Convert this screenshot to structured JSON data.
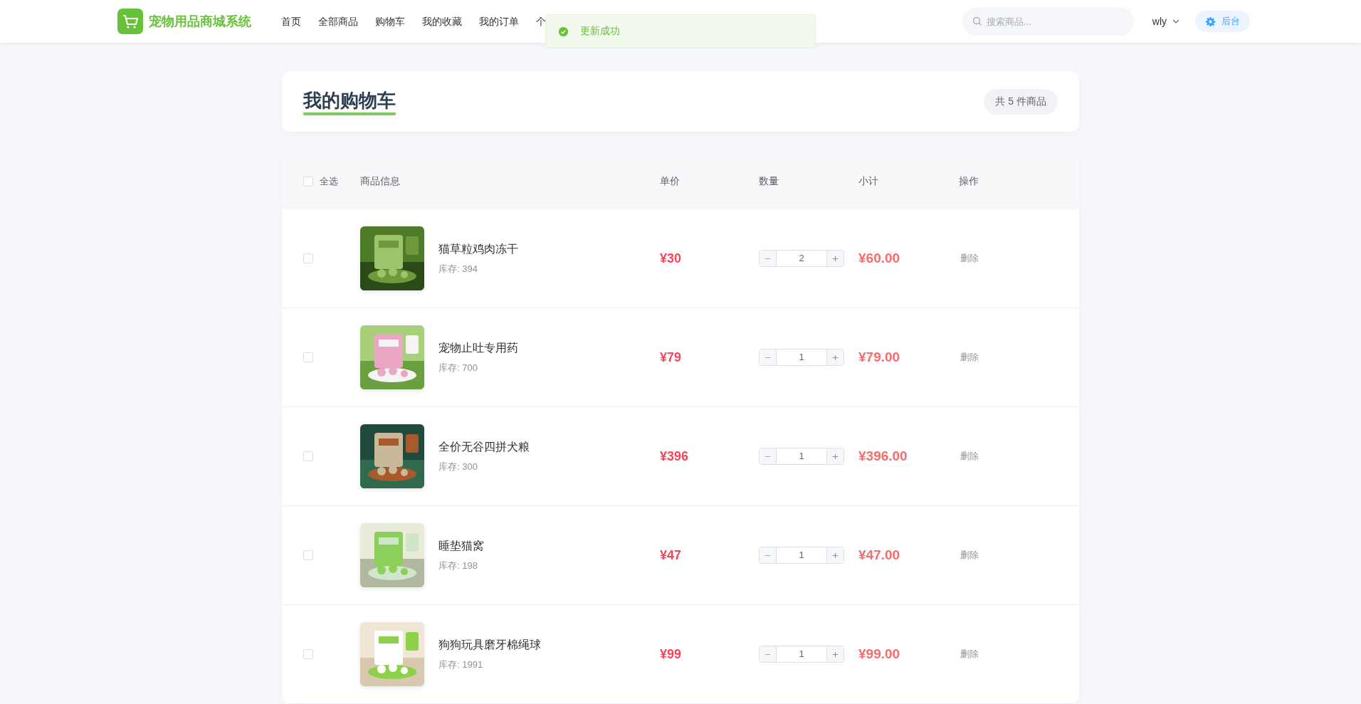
{
  "header": {
    "logo": "宠物用品商城系统",
    "nav": [
      {
        "label": "首页",
        "selected": false
      },
      {
        "label": "全部商品",
        "selected": false
      },
      {
        "label": "购物车",
        "selected": false
      },
      {
        "label": "我的收藏",
        "selected": false
      },
      {
        "label": "我的订单",
        "selected": false
      },
      {
        "label": "个",
        "selected": false
      }
    ],
    "search": {
      "placeholder": "搜索商品..."
    },
    "user": "wly",
    "admin_button": "后台"
  },
  "toast": {
    "kind": "success",
    "text": "更新成功"
  },
  "page_title": "我的购物车",
  "count_badge": "共 5 件商品",
  "table": {
    "select_all": {
      "label": "全选",
      "checked": false
    },
    "columns": [
      "商品信息",
      "单价",
      "数量",
      "小计",
      "操作"
    ],
    "rows": [
      {
        "checked": false,
        "name": "猫草粒鸡肉冻干",
        "stock": "库存: 394",
        "price": "¥30",
        "quantity": "2",
        "subtotal": "¥60.00",
        "action": "删除"
      },
      {
        "checked": false,
        "name": "宠物止吐专用药",
        "stock": "库存: 700",
        "price": "¥79",
        "quantity": "1",
        "subtotal": "¥79.00",
        "action": "删除"
      },
      {
        "checked": false,
        "name": "全价无谷四拼犬粮",
        "stock": "库存: 300",
        "price": "¥396",
        "quantity": "1",
        "subtotal": "¥396.00",
        "action": "删除"
      },
      {
        "checked": false,
        "name": "睡垫猫窝",
        "stock": "库存: 198",
        "price": "¥47",
        "quantity": "1",
        "subtotal": "¥47.00",
        "action": "删除"
      },
      {
        "checked": false,
        "name": "狗狗玩具磨牙棉绳球",
        "stock": "库存: 1991",
        "price": "¥99",
        "quantity": "1",
        "subtotal": "¥99.00",
        "action": "删除"
      }
    ]
  }
}
